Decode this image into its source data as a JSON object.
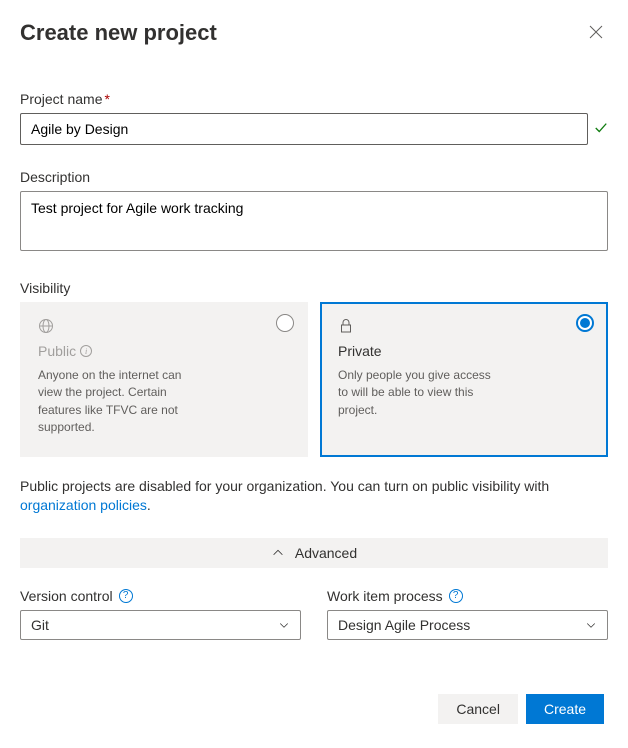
{
  "dialog": {
    "title": "Create new project",
    "projectName": {
      "label": "Project name",
      "value": "Agile by Design"
    },
    "description": {
      "label": "Description",
      "value": "Test project for Agile work tracking"
    },
    "visibility": {
      "label": "Visibility",
      "public": {
        "title": "Public",
        "desc": "Anyone on the internet can view the project. Certain features like TFVC are not supported."
      },
      "private": {
        "title": "Private",
        "desc": "Only people you give access to will be able to view this project."
      },
      "notePrefix": "Public projects are disabled for your organization. You can turn on public visibility with ",
      "noteLink": "organization policies",
      "noteSuffix": "."
    },
    "advanced": "Advanced",
    "versionControl": {
      "label": "Version control",
      "value": "Git"
    },
    "workItemProcess": {
      "label": "Work item process",
      "value": "Design Agile Process"
    },
    "buttons": {
      "cancel": "Cancel",
      "create": "Create"
    }
  }
}
